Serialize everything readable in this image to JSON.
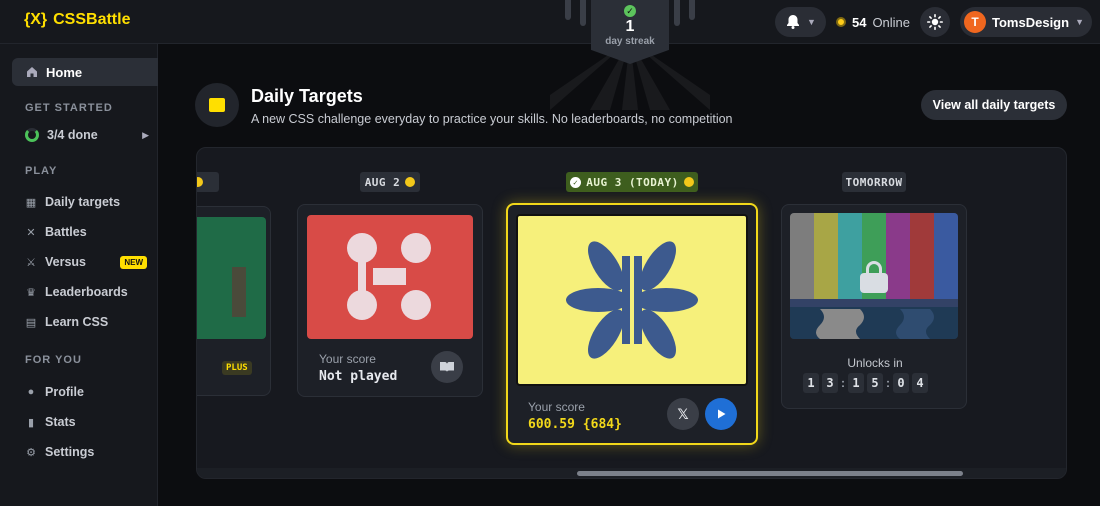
{
  "app": {
    "logo_mark": "{X}",
    "name": "CSSBattle"
  },
  "streak": {
    "count": "1",
    "label": "day streak"
  },
  "top_right": {
    "online_count": "54",
    "online_label": "Online",
    "user_initial": "T",
    "username": "TomsDesign"
  },
  "sidebar": {
    "home": "Home",
    "get_started_title": "GET STARTED",
    "progress": "3/4 done",
    "play_title": "PLAY",
    "play_items": [
      {
        "label": "Daily targets",
        "icon": "calendar-icon"
      },
      {
        "label": "Battles",
        "icon": "swords-icon"
      },
      {
        "label": "Versus",
        "icon": "versus-icon",
        "badge": "NEW"
      },
      {
        "label": "Leaderboards",
        "icon": "trophy-icon"
      },
      {
        "label": "Learn CSS",
        "icon": "book-icon"
      }
    ],
    "for_you_title": "FOR YOU",
    "you_items": [
      {
        "label": "Profile",
        "icon": "user-icon"
      },
      {
        "label": "Stats",
        "icon": "stats-icon"
      },
      {
        "label": "Settings",
        "icon": "gear-icon"
      }
    ]
  },
  "main": {
    "title": "Daily Targets",
    "subtitle": "A new CSS challenge everyday to practice your skills. No leaderboards, no competition",
    "view_all": "View all daily targets"
  },
  "cards": {
    "prev": {
      "badge": "PLUS"
    },
    "aug2": {
      "date": "AUG 2",
      "score_label": "Your score",
      "score_value": "Not played"
    },
    "today": {
      "date": "AUG 3 (TODAY)",
      "score_label": "Your score",
      "score_value": "600.59 {684}"
    },
    "tomorrow": {
      "date": "TOMORROW",
      "unlock_label": "Unlocks in",
      "timer": [
        "1",
        "3",
        ":",
        "1",
        "5",
        ":",
        "0",
        "4"
      ]
    }
  },
  "colors": {
    "accent": "#ffdf00",
    "today_border": "#f2d81a",
    "red_target": "#d84b47",
    "yellow_target": "#f6f07b",
    "blue_shape": "#3d5a8e"
  }
}
